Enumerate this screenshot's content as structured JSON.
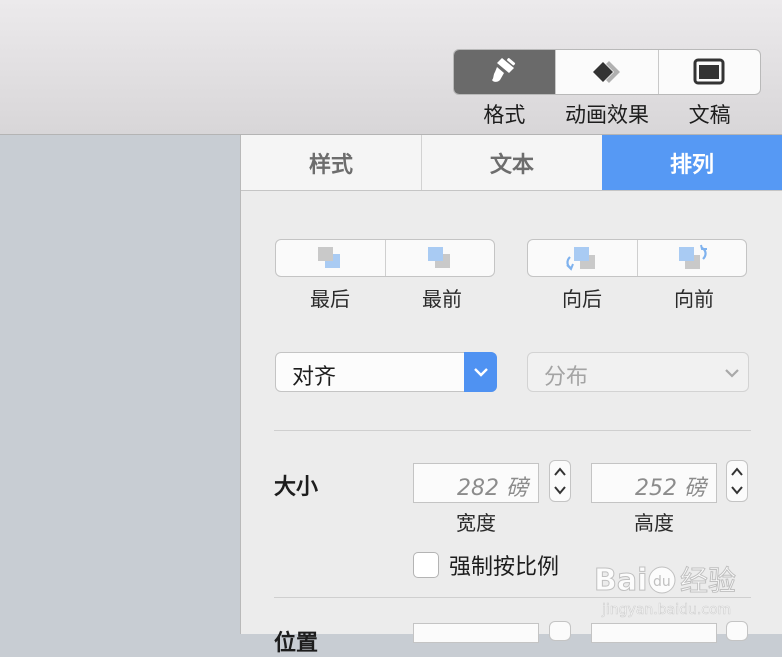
{
  "toolbar": {
    "buttons": [
      {
        "icon": "paintbrush-icon",
        "label": "格式",
        "active": true
      },
      {
        "icon": "animation-diamond-icon",
        "label": "动画效果",
        "active": false
      },
      {
        "icon": "document-icon",
        "label": "文稿",
        "active": false
      }
    ]
  },
  "inspector": {
    "tabs": [
      {
        "label": "样式",
        "active": false
      },
      {
        "label": "文本",
        "active": false
      },
      {
        "label": "排列",
        "active": true
      }
    ],
    "arrange_buttons": [
      "最后",
      "最前",
      "向后",
      "向前"
    ],
    "align_select": {
      "value": "对齐",
      "enabled": true
    },
    "distribute_select": {
      "value": "分布",
      "enabled": false
    },
    "size": {
      "label": "大小",
      "width_value": "282 磅",
      "width_caption": "宽度",
      "height_value": "252 磅",
      "height_caption": "高度",
      "constrain_label": "强制按比例",
      "constrain_checked": false
    },
    "position_label": "位置"
  },
  "watermark": {
    "brand": "Baidu经验",
    "url": "jingyan.baidu.com"
  },
  "colors": {
    "accent": "#5699f4",
    "active_toolbar": "#6a6a6a"
  }
}
